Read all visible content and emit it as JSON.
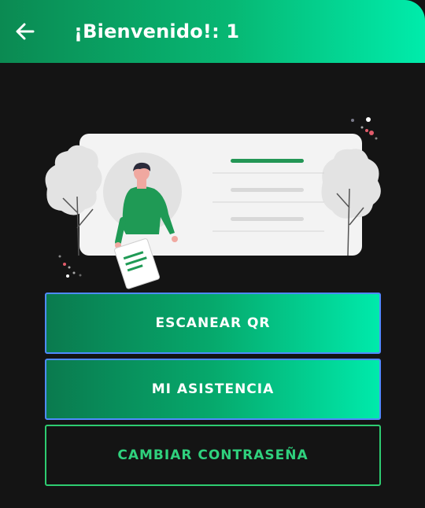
{
  "appbar": {
    "title": "¡Bienvenido!: 1",
    "back_icon": "arrow-left-icon"
  },
  "colors": {
    "accent_start": "#0b8a52",
    "accent_end": "#00ecab",
    "outline_green": "#2ecc71",
    "focus_border": "#4f8bff",
    "background": "#141414"
  },
  "illustration": {
    "icon": "person-profile-illustration"
  },
  "actions": {
    "scan_qr_label": "ESCANEAR QR",
    "my_attendance_label": "MI ASISTENCIA",
    "change_password_label": "CAMBIAR CONTRASEÑA"
  }
}
